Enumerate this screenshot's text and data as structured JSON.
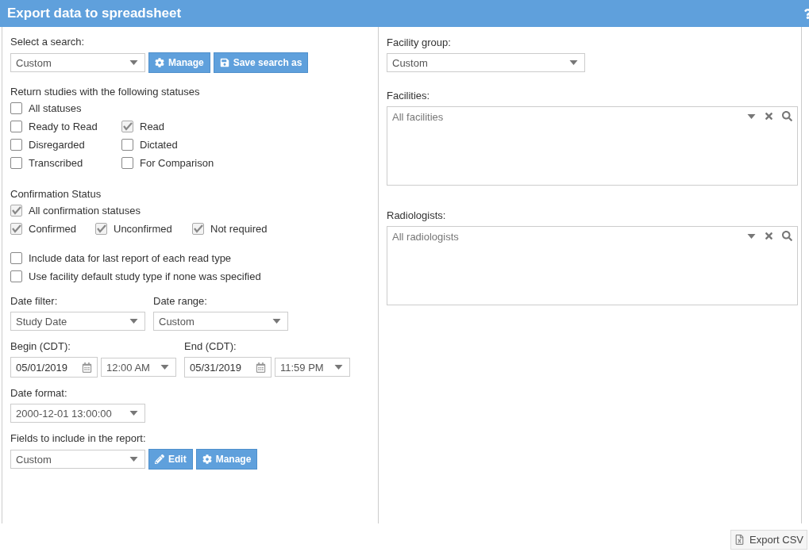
{
  "window": {
    "title": "Export data to spreadsheet"
  },
  "search": {
    "label": "Select a search:",
    "value": "Custom",
    "buttons": [
      {
        "kind": "manage",
        "label": "Manage"
      },
      {
        "kind": "save",
        "label": "Save search as"
      }
    ]
  },
  "statuses": {
    "heading": "Return studies with the following statuses",
    "rows": [
      [
        {
          "label": "All statuses",
          "checked": false
        }
      ],
      [
        {
          "label": "Ready to Read",
          "checked": false
        },
        {
          "label": "Read",
          "checked": true
        }
      ],
      [
        {
          "label": "Disregarded",
          "checked": false
        },
        {
          "label": "Dictated",
          "checked": false
        }
      ],
      [
        {
          "label": "Transcribed",
          "checked": false
        },
        {
          "label": "For Comparison",
          "checked": false
        }
      ]
    ]
  },
  "confirmation": {
    "heading": "Confirmation Status",
    "rows": [
      [
        {
          "label": "All confirmation statuses",
          "checked": true
        }
      ],
      [
        {
          "label": "Confirmed",
          "checked": true
        },
        {
          "label": "Unconfirmed",
          "checked": true
        },
        {
          "label": "Not required",
          "checked": true
        }
      ]
    ]
  },
  "options": [
    {
      "label": "Include data for last report of each read type",
      "checked": false
    },
    {
      "label": "Use facility default study type if none was specified",
      "checked": false
    }
  ],
  "date_filter": {
    "label": "Date filter:",
    "value": "Study Date"
  },
  "date_range": {
    "label": "Date range:",
    "value": "Custom"
  },
  "begin": {
    "label": "Begin (CDT):",
    "date": "05/01/2019",
    "time": "12:00 AM"
  },
  "end": {
    "label": "End (CDT):",
    "date": "05/31/2019",
    "time": "11:59 PM"
  },
  "date_format": {
    "label": "Date format:",
    "value": "2000-12-01 13:00:00"
  },
  "fields": {
    "label": "Fields to include in the report:",
    "value": "Custom",
    "buttons": [
      {
        "kind": "edit",
        "label": "Edit"
      },
      {
        "kind": "manage",
        "label": "Manage"
      }
    ]
  },
  "facility_group": {
    "label": "Facility group:",
    "value": "Custom"
  },
  "facilities": {
    "label": "Facilities:",
    "placeholder": "All facilities"
  },
  "radiologists": {
    "label": "Radiologists:",
    "placeholder": "All radiologists"
  },
  "export_button": {
    "label": "Export CSV"
  }
}
